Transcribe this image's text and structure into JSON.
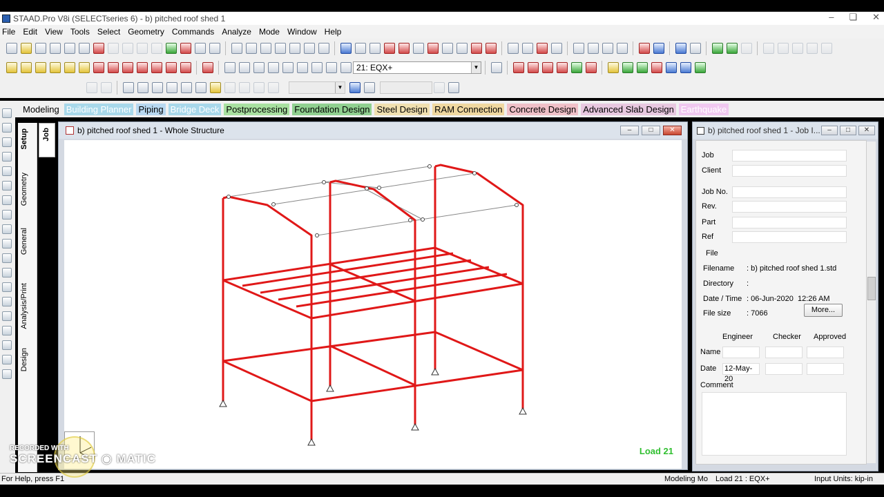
{
  "window": {
    "title": "STAAD.Pro V8i (SELECTseries 6) - b) pitched roof shed 1"
  },
  "menu": [
    "File",
    "Edit",
    "View",
    "Tools",
    "Select",
    "Geometry",
    "Commands",
    "Analyze",
    "Mode",
    "Window",
    "Help"
  ],
  "toolbar": {
    "load_combo": "21: EQX+"
  },
  "page_tabs": [
    {
      "label": "Modeling",
      "color": "#f0f0f0"
    },
    {
      "label": "Building Planner",
      "color": "#a8d8ea"
    },
    {
      "label": "Piping",
      "color": "#b8d8f0"
    },
    {
      "label": "Bridge Deck",
      "color": "#a8d8ea"
    },
    {
      "label": "Postprocessing",
      "color": "#a8e0a0"
    },
    {
      "label": "Foundation Design",
      "color": "#90d090"
    },
    {
      "label": "Steel Design",
      "color": "#f0e0b0"
    },
    {
      "label": "RAM Connection",
      "color": "#f0d8a0"
    },
    {
      "label": "Concrete Design",
      "color": "#f0c0c8"
    },
    {
      "label": "Advanced Slab Design",
      "color": "#e8c8e0"
    },
    {
      "label": "Earthquake",
      "color": "#f0c8f0"
    }
  ],
  "side_tabs": {
    "job": "Job",
    "setup": "Setup",
    "geometry": "Geometry",
    "general": "General",
    "analysis": "Analysis/Print",
    "design": "Design"
  },
  "structure_window": {
    "title": "b) pitched roof shed 1 - Whole Structure",
    "load_label": "Load 21"
  },
  "job_panel": {
    "title": "b) pitched roof shed 1 - Job I...",
    "fields": [
      {
        "label": "Job",
        "value": ""
      },
      {
        "label": "Client",
        "value": ""
      },
      {
        "label": "Job No.",
        "value": ""
      },
      {
        "label": "Rev.",
        "value": ""
      },
      {
        "label": "Part",
        "value": ""
      },
      {
        "label": "Ref",
        "value": ""
      }
    ],
    "file_group": "File",
    "file_info": {
      "filename_label": "Filename",
      "filename": ": b) pitched roof shed 1.std",
      "directory_label": "Directory",
      "directory": ":",
      "datetime_label": "Date / Time",
      "date": ": 06-Jun-2020",
      "time": "12:26 AM",
      "filesize_label": "File size",
      "filesize": ": 7066",
      "more_button": "More..."
    },
    "roles": {
      "engineer": "Engineer",
      "checker": "Checker",
      "approved": "Approved"
    },
    "name_label": "Name",
    "date_label": "Date",
    "engineer_date": "12-May-20",
    "comment_label": "Comment"
  },
  "status_bar": {
    "help": "For Help, press F1",
    "mode": "Modeling Mo",
    "load": "Load 21 : EQX+",
    "units": "Input Units:  kip-in"
  },
  "watermark": {
    "line1": "RECORDED WITH",
    "line2": "SCREENCAST",
    "line3": "MATIC"
  },
  "colors": {
    "members": "#e01818",
    "load_label": "#2fbf2f"
  }
}
